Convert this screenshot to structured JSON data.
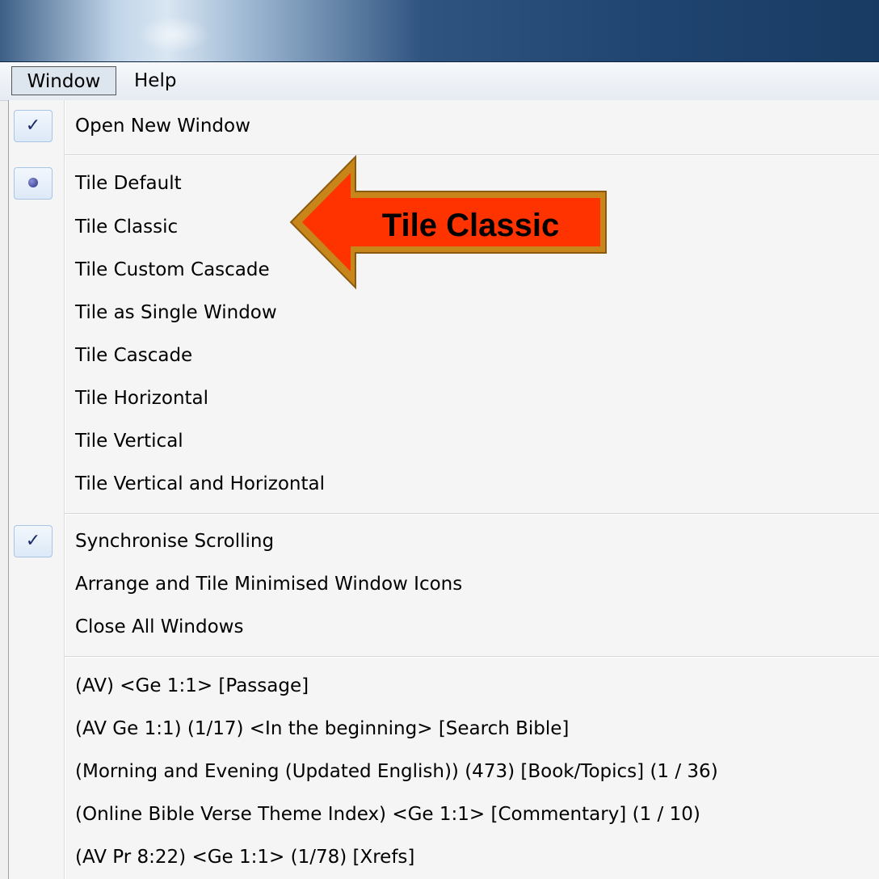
{
  "menubar": {
    "items": [
      "Window",
      "Help"
    ]
  },
  "menu": {
    "group1": [
      {
        "label": "Open New Window",
        "state": "checked"
      }
    ],
    "group2": [
      {
        "label": "Tile Default",
        "state": "radio"
      },
      {
        "label": "Tile Classic"
      },
      {
        "label": "Tile Custom Cascade"
      },
      {
        "label": "Tile as Single Window"
      },
      {
        "label": "Tile Cascade"
      },
      {
        "label": "Tile Horizontal"
      },
      {
        "label": "Tile Vertical"
      },
      {
        "label": "Tile Vertical and Horizontal"
      }
    ],
    "group3": [
      {
        "label": "Synchronise Scrolling",
        "state": "checked"
      },
      {
        "label": "Arrange and Tile Minimised Window Icons"
      },
      {
        "label": "Close All Windows"
      }
    ],
    "group4": [
      {
        "label": "(AV) <Ge 1:1> [Passage]"
      },
      {
        "label": "(AV Ge 1:1) (1/17) <In the beginning> [Search Bible]"
      },
      {
        "label": "(Morning and Evening  (Updated English)) (473) [Book/Topics] (1 / 36)"
      },
      {
        "label": "(Online Bible Verse Theme Index) <Ge 1:1> [Commentary] (1 / 10)"
      },
      {
        "label": "(AV Pr 8:22) <Ge 1:1> (1/78) [Xrefs]"
      }
    ]
  },
  "callout": {
    "label": "Tile Classic",
    "color": "#ff3300",
    "border": "#c8861a"
  },
  "icons": {
    "check": "✓"
  }
}
